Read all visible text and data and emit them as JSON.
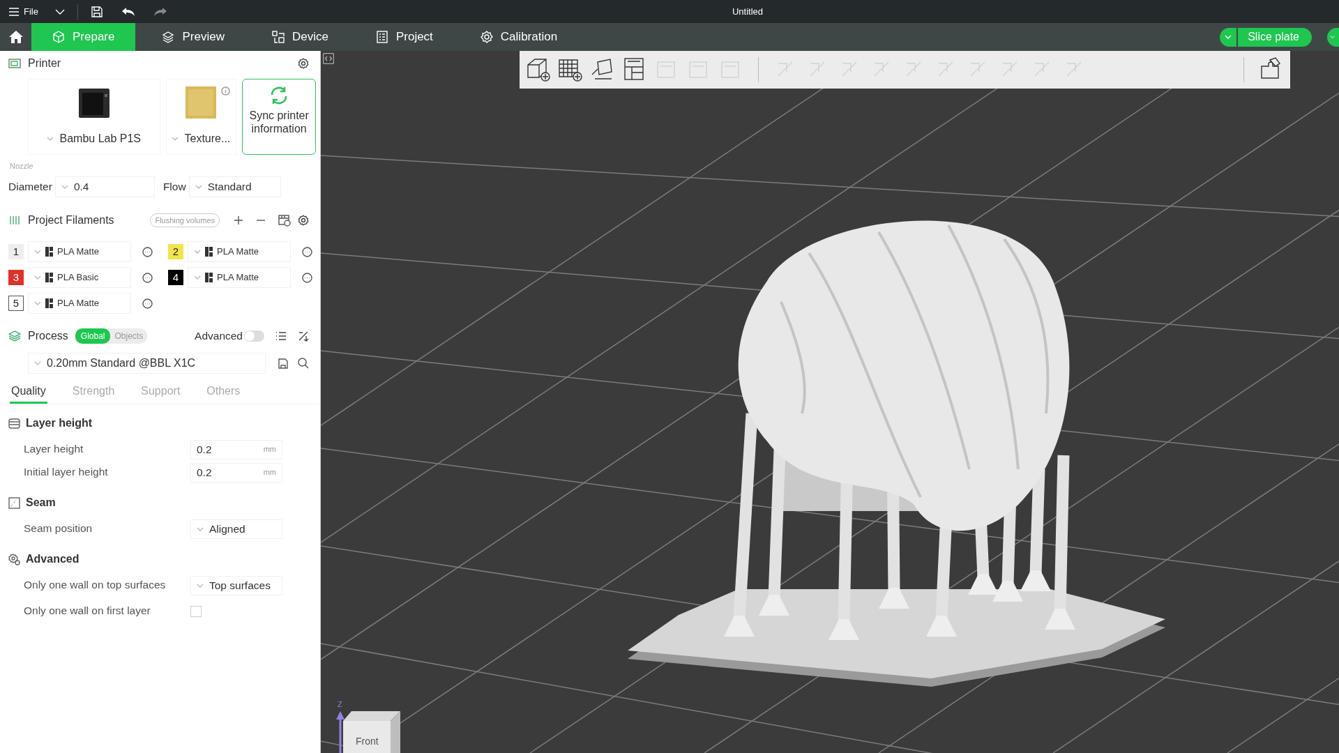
{
  "title_bar": {
    "menu_label": "File",
    "title": "Untitled"
  },
  "tabs": [
    {
      "label": "Prepare",
      "selected": true
    },
    {
      "label": "Preview",
      "selected": false
    },
    {
      "label": "Device",
      "selected": false
    },
    {
      "label": "Project",
      "selected": false
    },
    {
      "label": "Calibration",
      "selected": false
    }
  ],
  "slice_button": "Slice plate",
  "printer": {
    "heading": "Printer",
    "model": "Bambu Lab P1S",
    "plate": "Texture...",
    "sync_button": "Sync printer information",
    "nozzle_label": "Nozzle",
    "diameter_label": "Diameter",
    "diameter": "0.4",
    "flow_label": "Flow",
    "flow": "Standard"
  },
  "filaments": {
    "heading": "Project Filaments",
    "flushing_button": "Flushing volumes",
    "items": [
      {
        "number": "1",
        "name": "PLA Matte",
        "color": "#eeeeee"
      },
      {
        "number": "2",
        "name": "PLA Matte",
        "color": "#f3e44a"
      },
      {
        "number": "3",
        "name": "PLA Basic",
        "color": "#e0302a"
      },
      {
        "number": "4",
        "name": "PLA Matte",
        "color": "#000000"
      },
      {
        "number": "5",
        "name": "PLA Matte",
        "color": "#ffffff"
      }
    ]
  },
  "process": {
    "heading": "Process",
    "scope": [
      {
        "label": "Global",
        "selected": true
      },
      {
        "label": "Objects",
        "selected": false
      }
    ],
    "advanced_label": "Advanced",
    "advanced_on": false,
    "preset": "0.20mm Standard @BBL X1C",
    "tabs": [
      {
        "label": "Quality",
        "selected": true
      },
      {
        "label": "Strength",
        "selected": false
      },
      {
        "label": "Support",
        "selected": false
      },
      {
        "label": "Others",
        "selected": false
      }
    ],
    "groups": [
      {
        "title": "Layer height",
        "settings": [
          {
            "kind": "number",
            "label": "Layer height",
            "value": "0.2",
            "unit": "mm"
          },
          {
            "kind": "number",
            "label": "Initial layer height",
            "value": "0.2",
            "unit": "mm"
          }
        ]
      },
      {
        "title": "Seam",
        "settings": [
          {
            "kind": "select",
            "label": "Seam position",
            "value": "Aligned"
          }
        ]
      },
      {
        "title": "Advanced",
        "settings": [
          {
            "kind": "select",
            "label": "Only one wall on top surfaces",
            "value": "Top surfaces"
          },
          {
            "kind": "checkbox",
            "label": "Only one wall on first layer",
            "checked": false
          }
        ]
      }
    ]
  },
  "viewport": {
    "axis_label": "Z",
    "cube_face": "Front"
  }
}
